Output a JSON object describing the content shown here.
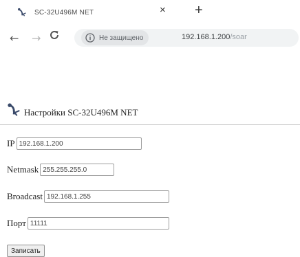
{
  "browser": {
    "tab_title": "SC-32U496M NET",
    "close_glyph": "×",
    "new_tab_glyph": "+",
    "back_glyph": "←",
    "forward_glyph": "→",
    "security_text": "Не защищено",
    "url_host": "192.168.1.200",
    "url_path": "/soar"
  },
  "page": {
    "title": "Настройки SC-32U496M NET",
    "fields": {
      "ip": {
        "label": "IP",
        "value": "192.168.1.200"
      },
      "netmask": {
        "label": "Netmask",
        "value": "255.255.255.0"
      },
      "broadcast": {
        "label": "Broadcast",
        "value": "192.168.1.255"
      },
      "port": {
        "label": "Порт",
        "value": "11111"
      }
    },
    "submit_label": "Записать"
  },
  "icons": {
    "tab": "satellite-dish-icon",
    "reload": "reload-icon",
    "security": "info-icon",
    "logo": "satellite-dish-icon"
  },
  "colors": {
    "logo": "#3a4a6a",
    "field_border": "#9d9d9d",
    "omnibox_bg": "#f1f3f4"
  }
}
